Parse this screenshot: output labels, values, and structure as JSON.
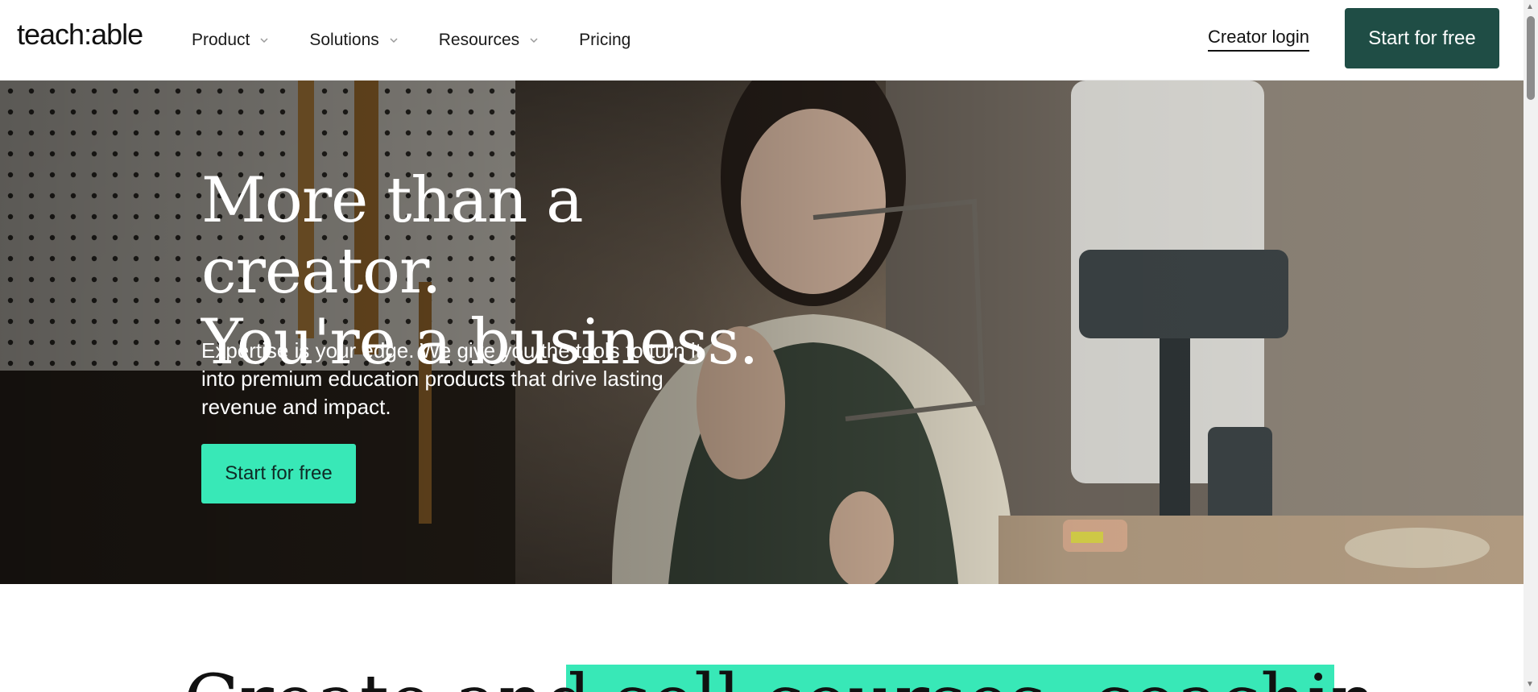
{
  "header": {
    "logo": "teach:able",
    "nav": [
      {
        "label": "Product",
        "has_dropdown": true
      },
      {
        "label": "Solutions",
        "has_dropdown": true
      },
      {
        "label": "Resources",
        "has_dropdown": true
      },
      {
        "label": "Pricing",
        "has_dropdown": false
      }
    ],
    "creator_login": "Creator login",
    "cta": "Start for free",
    "cta_color": "#1f4d45"
  },
  "hero": {
    "title_line1": "More than a creator.",
    "title_line2": "You're a business.",
    "subtitle": "Expertise is your edge. We give you the tools to turn it into premium education products that drive lasting revenue and impact.",
    "cta": "Start for free",
    "cta_color": "#38e8b7"
  },
  "lower": {
    "heading_partial": "Create and sell courses, coaching and"
  },
  "icons": {
    "chevron": "chevron-down-icon"
  }
}
